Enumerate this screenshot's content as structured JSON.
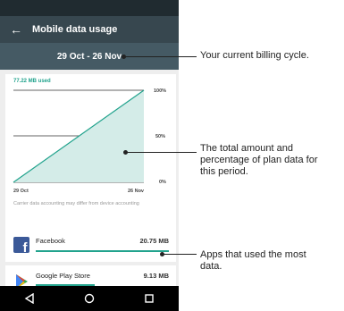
{
  "appbar": {
    "title": "Mobile data usage"
  },
  "cycle": {
    "label": "29 Oct - 26 Nov"
  },
  "usage": {
    "used_label": "77.22 MB used",
    "start_date": "29 Oct",
    "end_date": "26 Nov",
    "y_ticks": [
      "100%",
      "50%",
      "0%"
    ],
    "disclaimer": "Carrier data accounting may differ from device accounting"
  },
  "apps": [
    {
      "name": "Facebook",
      "size": "20.75 MB",
      "icon": "facebook-icon",
      "share": 1.0
    },
    {
      "name": "Google Play Store",
      "size": "9.13 MB",
      "icon": "play-store-icon",
      "share": 0.44
    }
  ],
  "nav": {
    "icons": [
      "back-icon",
      "home-icon",
      "recents-icon"
    ]
  },
  "callouts": [
    {
      "text": "Your current billing cycle."
    },
    {
      "text": "The total amount and percentage of plan data for this period."
    },
    {
      "text": "Apps that used the most data."
    }
  ],
  "colors": {
    "accent": "#22a38d",
    "appbar": "#37474f",
    "cycle_bar": "#455a64",
    "facebook": "#3b5998"
  }
}
